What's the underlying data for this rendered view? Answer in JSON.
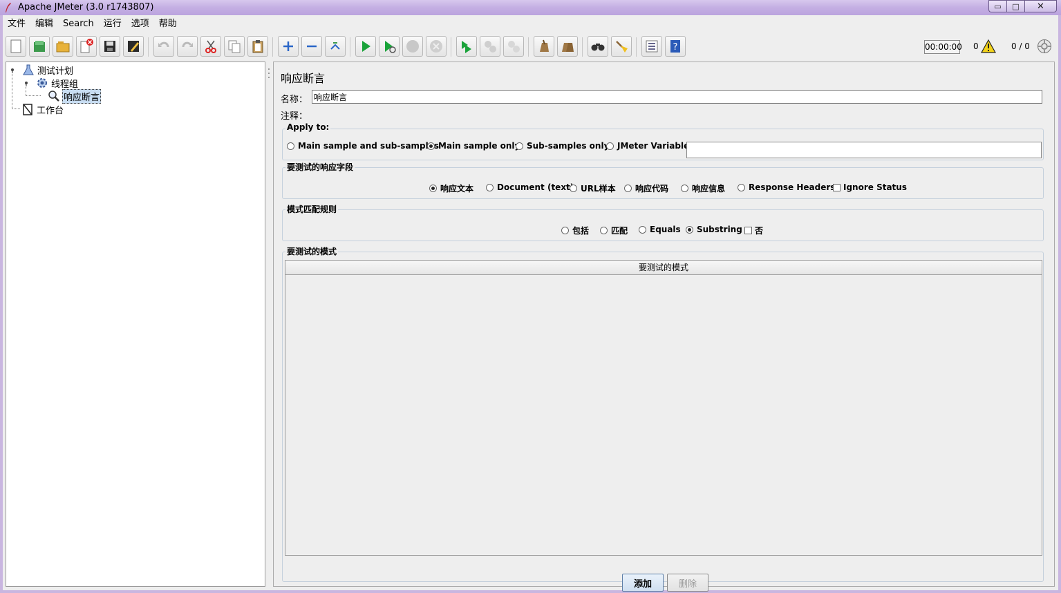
{
  "window": {
    "title": "Apache JMeter (3.0 r1743807)",
    "controls": {
      "minimize": "▭",
      "maximize": "□",
      "close": "✕"
    }
  },
  "menubar": {
    "items": [
      "文件",
      "编辑",
      "Search",
      "运行",
      "选项",
      "帮助"
    ]
  },
  "toolbar": {
    "timer": "00:00:00",
    "error_count": "0",
    "thread_count": "0 / 0",
    "icons": [
      "new-icon",
      "templates-icon",
      "open-icon",
      "close-icon",
      "save-icon",
      "save-as-icon",
      "undo-icon",
      "redo-icon",
      "cut-icon",
      "copy-icon",
      "paste-icon",
      "expand-icon",
      "collapse-icon",
      "toggle-icon",
      "start-icon",
      "start-no-pause-icon",
      "stop-icon",
      "shutdown-icon",
      "remote-start-icon",
      "remote-stop-icon",
      "remote-shutdown-icon",
      "clear-icon",
      "clear-all-icon",
      "search-icon",
      "reset-search-icon",
      "function-helper-icon",
      "help-icon"
    ]
  },
  "tree": {
    "items": [
      {
        "label": "测试计划",
        "icon": "test-plan-icon"
      },
      {
        "label": "线程组",
        "icon": "thread-group-icon"
      },
      {
        "label": "响应断言",
        "icon": "assertion-icon",
        "selected": true
      },
      {
        "label": "工作台",
        "icon": "workbench-icon"
      }
    ]
  },
  "panel": {
    "title": "响应断言",
    "name_label": "名称：",
    "name_value": "响应断言",
    "comment_label": "注释：",
    "apply_to": {
      "title": "Apply to:",
      "options": [
        {
          "label": "Main sample and sub-samples",
          "selected": false
        },
        {
          "label": "Main sample only",
          "selected": true
        },
        {
          "label": "Sub-samples only",
          "selected": false
        },
        {
          "label": "JMeter Variable",
          "selected": false
        }
      ]
    },
    "response_field": {
      "title": "要测试的响应字段",
      "options": [
        {
          "label": "响应文本",
          "selected": true
        },
        {
          "label": "Document (text)",
          "selected": false
        },
        {
          "label": "URL样本",
          "selected": false
        },
        {
          "label": "响应代码",
          "selected": false
        },
        {
          "label": "响应信息",
          "selected": false
        },
        {
          "label": "Response Headers",
          "selected": false
        }
      ],
      "ignore_status": {
        "label": "Ignore Status",
        "checked": false
      }
    },
    "matching_rules": {
      "title": "模式匹配规则",
      "options": [
        {
          "label": "包括",
          "selected": false
        },
        {
          "label": "匹配",
          "selected": false
        },
        {
          "label": "Equals",
          "selected": false
        },
        {
          "label": "Substring",
          "selected": true
        }
      ],
      "not": {
        "label": "否",
        "checked": false
      }
    },
    "patterns": {
      "title": "要测试的模式",
      "column_header": "要测试的模式",
      "rows": []
    },
    "buttons": {
      "add": "添加",
      "delete": "删除"
    }
  }
}
